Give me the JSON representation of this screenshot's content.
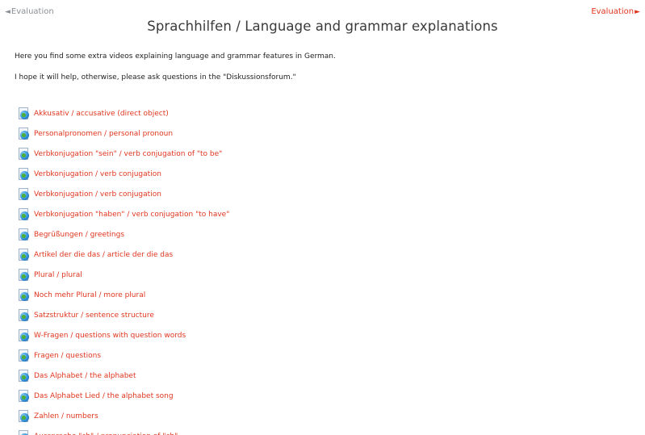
{
  "navigation": {
    "prev_label": "Evaluation",
    "next_label": "Evaluation"
  },
  "page": {
    "title": "Sprachhilfen / Language and grammar explanations",
    "intro_1": "Here you find some extra videos explaining language and grammar features in German.",
    "intro_2": "I hope it will help, otherwise, please ask questions in the \"Diskussionsforum.\""
  },
  "links": [
    {
      "label": "Akkusativ / accusative (direct object)",
      "icon": "url-globe-icon"
    },
    {
      "label": "Personalpronomen / personal pronoun",
      "icon": "url-globe-icon"
    },
    {
      "label": "Verbkonjugation \"sein\" / verb conjugation of \"to be\"",
      "icon": "url-globe-icon"
    },
    {
      "label": "Verbkonjugation / verb conjugation",
      "icon": "url-globe-icon"
    },
    {
      "label": "Verbkonjugation / verb conjugation",
      "icon": "url-globe-icon"
    },
    {
      "label": "Verbkonjugation \"haben\" / verb conjugation \"to have\"",
      "icon": "url-globe-icon"
    },
    {
      "label": "Begrüßungen / greetings",
      "icon": "url-globe-icon"
    },
    {
      "label": "Artikel der die das / article der die das",
      "icon": "url-globe-icon"
    },
    {
      "label": "Plural / plural",
      "icon": "url-globe-icon"
    },
    {
      "label": "Noch mehr Plural / more plural",
      "icon": "url-globe-icon"
    },
    {
      "label": "Satzstruktur / sentence structure",
      "icon": "url-globe-icon"
    },
    {
      "label": "W-Fragen / questions with question words",
      "icon": "url-globe-icon"
    },
    {
      "label": "Fragen / questions",
      "icon": "url-globe-icon"
    },
    {
      "label": "Das Alphabet / the alphabet",
      "icon": "url-globe-icon"
    },
    {
      "label": "Das Alphabet Lied / the alphabet song",
      "icon": "url-globe-icon"
    },
    {
      "label": "Zahlen / numbers",
      "icon": "url-globe-icon"
    },
    {
      "label": "Aussprache \"ch\" / pronunciation of \"ch\"",
      "icon": "url-globe-icon"
    }
  ],
  "colors": {
    "link": "#e0361f",
    "nav_prev": "#8a8f95",
    "title": "#3a3a3a",
    "body_text": "#222222"
  }
}
